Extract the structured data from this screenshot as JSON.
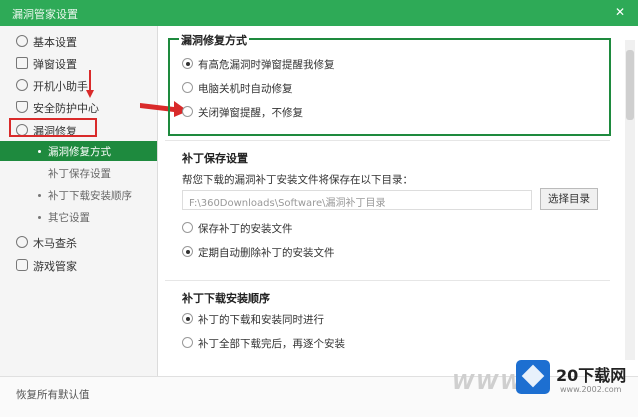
{
  "window": {
    "title": "漏洞管家设置",
    "close_glyph": "✕"
  },
  "sidebar": {
    "items": [
      {
        "label": "基本设置",
        "icon": "gear-icon"
      },
      {
        "label": "弹窗设置",
        "icon": "popup-icon"
      },
      {
        "label": "开机小助手",
        "icon": "clock-icon"
      },
      {
        "label": "安全防护中心",
        "icon": "shield-icon"
      },
      {
        "label": "漏洞修复",
        "icon": "bug-icon"
      }
    ],
    "subitems": [
      {
        "label": "漏洞修复方式",
        "active": true
      },
      {
        "label": "补丁保存设置",
        "active": false
      },
      {
        "label": "补丁下载安装顺序",
        "active": false
      },
      {
        "label": "其它设置",
        "active": false
      }
    ],
    "items_after": [
      {
        "label": "木马查杀",
        "icon": "horse-icon"
      },
      {
        "label": "游戏管家",
        "icon": "gamepad-icon"
      }
    ]
  },
  "repair_method": {
    "title": "漏洞修复方式",
    "options": [
      {
        "label": "有高危漏洞时弹窗提醒我修复",
        "checked": true
      },
      {
        "label": "电脑关机时自动修复",
        "checked": false
      },
      {
        "label": "关闭弹窗提醒，不修复",
        "checked": false
      }
    ]
  },
  "patch_save": {
    "title": "补丁保存设置",
    "description": "帮您下载的漏洞补丁安装文件将保存在以下目录：",
    "path": "F:\\360Downloads\\Software\\漏洞补丁目录",
    "select_label": "选择目录",
    "options": [
      {
        "label": "保存补丁的安装文件",
        "checked": false
      },
      {
        "label": "定期自动删除补丁的安装文件",
        "checked": true
      }
    ]
  },
  "install_order": {
    "title": "补丁下载安装顺序",
    "options": [
      {
        "label": "补丁的下载和安装同时进行",
        "checked": true
      },
      {
        "label": "补丁全部下载完后，再逐个安装",
        "checked": false
      }
    ]
  },
  "footer": {
    "restore_label": "恢复所有默认值"
  },
  "watermark": {
    "www": "WWW",
    "brand": "20下载网",
    "url": "www.2002.com"
  },
  "colors": {
    "accent": "#2eaa57",
    "active": "#1e8a3e",
    "annotation": "#d92a2a"
  }
}
